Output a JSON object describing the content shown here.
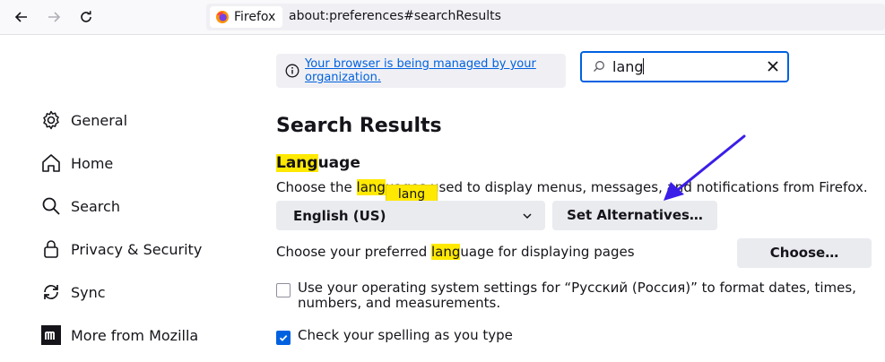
{
  "browser": {
    "identity_label": "Firefox",
    "url": "about:preferences#searchResults"
  },
  "sidebar": {
    "items": [
      {
        "label": "General",
        "icon": "gear-icon"
      },
      {
        "label": "Home",
        "icon": "home-icon"
      },
      {
        "label": "Search",
        "icon": "search-icon"
      },
      {
        "label": "Privacy & Security",
        "icon": "lock-icon"
      },
      {
        "label": "Sync",
        "icon": "sync-icon"
      },
      {
        "label": "More from Mozilla",
        "icon": "mozilla-icon"
      }
    ]
  },
  "policy_notice": {
    "link_text": "Your browser is being managed by your organization."
  },
  "search": {
    "value": "lang"
  },
  "main": {
    "title": "Search Results",
    "section": {
      "title_highlight": "Lang",
      "title_rest": "uage",
      "desc_before": "Choose the ",
      "desc_highlight": "lang",
      "desc_after": "uages used to display menus, messages, and notifications from Firefox.",
      "tooltip": "lang",
      "select_value": "English (US)",
      "set_alternatives_label": "Set Alternatives…",
      "pages_before": "Choose your preferred ",
      "pages_highlight": "lang",
      "pages_after": "uage for displaying pages",
      "choose_label": "Choose…",
      "os_settings_label": "Use your operating system settings for “Русский (Россия)” to format dates, times, numbers, and measurements.",
      "spellcheck_label": "Check your spelling as you type",
      "spellcheck_checked": true,
      "os_settings_checked": false
    }
  },
  "colors": {
    "accent": "#0061e0",
    "highlight": "#ffe900",
    "annotation_arrow": "#3a1ee8"
  }
}
